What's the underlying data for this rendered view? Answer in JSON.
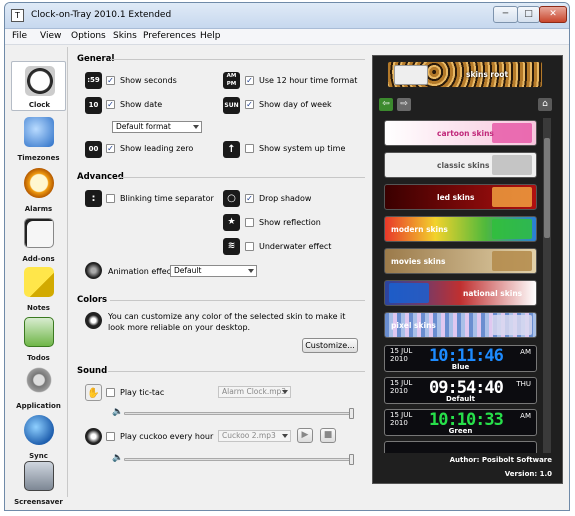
{
  "window": {
    "title": "Clock-on-Tray 2010.1 Extended",
    "icon_glyph": "T",
    "min": "─",
    "max": "□",
    "close": "✕"
  },
  "menu": [
    "File",
    "View",
    "Options",
    "Skins",
    "Preferences",
    "Help"
  ],
  "sidebar": [
    {
      "label": "Clock",
      "icon": "clock-icon",
      "active": true
    },
    {
      "label": "Timezones",
      "icon": "timezones-icon"
    },
    {
      "label": "Alarms",
      "icon": "alarm-clock-icon"
    },
    {
      "label": "Add-ons",
      "icon": "dice-icon"
    },
    {
      "label": "Notes",
      "icon": "notes-icon"
    },
    {
      "label": "Todos",
      "icon": "todos-icon"
    },
    {
      "label": "Application",
      "icon": "gear-icon"
    },
    {
      "label": "Sync",
      "icon": "sync-icon"
    },
    {
      "label": "Screensaver",
      "icon": "screensaver-icon"
    }
  ],
  "general": {
    "title": "General",
    "show_seconds": "Show seconds",
    "show_date": "Show date",
    "date_format": "Default format",
    "show_leading_zero": "Show leading zero",
    "use_12h": "Use 12 hour time format",
    "show_day_of_week": "Show day of week",
    "show_system_up_time": "Show system up time",
    "icons": {
      "seconds": ":59",
      "date": "10",
      "leading_zero": "00",
      "ampm_top": "AM",
      "ampm_bottom": "PM",
      "sun": "SUN",
      "uptime": "↑"
    }
  },
  "advanced": {
    "title": "Advanced",
    "blinking_separator": "Blinking time separator",
    "drop_shadow": "Drop shadow",
    "show_reflection": "Show reflection",
    "underwater_effect": "Underwater effect",
    "animation_effect_label": "Animation effect",
    "animation_effect_value": "Default"
  },
  "colors": {
    "title": "Colors",
    "description": "You can customize any color of the selected skin to make it look more reliable on your desktop.",
    "customize_button": "Customize..."
  },
  "sound": {
    "title": "Sound",
    "play_tic_tac": "Play tic-tac",
    "tic_tac_file": "Alarm Clock.mp3",
    "play_cuckoo": "Play cuckoo every hour",
    "cuckoo_file": "Cuckoo 2.mp3",
    "play_glyph": "▶",
    "stop_glyph": "■",
    "speaker_glyph": "🔈"
  },
  "skins_panel": {
    "root_label": "skins root",
    "back_glyph": "⇦",
    "forward_glyph": "⇨",
    "home_glyph": "⌂",
    "categories": [
      {
        "name": "cartoon skins",
        "color": "#f5d9e8"
      },
      {
        "name": "classic skins",
        "color": "#e9e9e9"
      },
      {
        "name": "led skins",
        "color": "#8a0a0a"
      },
      {
        "name": "modern skins",
        "color": "#58a840"
      },
      {
        "name": "movies skins",
        "color": "#c8b48a"
      },
      {
        "name": "national skins",
        "color": "#3a59b0"
      },
      {
        "name": "pixel skins",
        "color": "#b9b0d8"
      }
    ],
    "clocks": [
      {
        "date_top": "15 JUL",
        "date_bottom": "2010",
        "time": "10:11:46",
        "ampm": "AM",
        "name": "Blue",
        "color": "#1d8bff"
      },
      {
        "date_top": "15 JUL",
        "date_bottom": "2010",
        "time": "09:54:40",
        "ampm": "THU",
        "name": "Default",
        "color": "#ffffff"
      },
      {
        "date_top": "15 JUL",
        "date_bottom": "2010",
        "time": "10:10:33",
        "ampm": "AM",
        "name": "Green",
        "color": "#27e04a"
      }
    ],
    "author": "Author: Posibolt Software",
    "version": "Version: 1.0"
  }
}
